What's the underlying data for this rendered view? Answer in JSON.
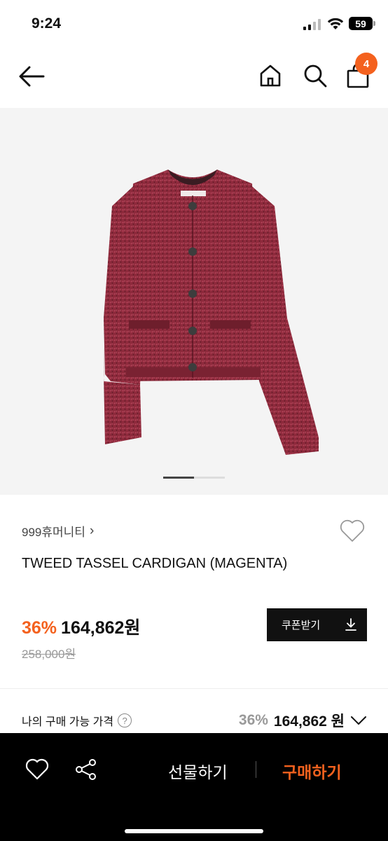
{
  "status_bar": {
    "time": "9:24",
    "battery": "59"
  },
  "nav": {
    "cart_count": "4"
  },
  "carousel": {
    "current_page": 1,
    "total_pages": 2
  },
  "product": {
    "brand": "999휴머니티",
    "brand_chevron": "›",
    "title": "TWEED TASSEL CARDIGAN (MAGENTA)",
    "discount": "36%",
    "price": "164,862원",
    "original_price": "258,000원",
    "coupon_label": "쿠폰받기"
  },
  "my_price": {
    "label": "나의 구매 가능 가격",
    "help": "?",
    "discount": "36%",
    "price": "164,862 원"
  },
  "bottom_bar": {
    "gift_label": "선물하기",
    "buy_label": "구매하기"
  },
  "colors": {
    "accent": "#f4611e",
    "dark": "#111111"
  }
}
